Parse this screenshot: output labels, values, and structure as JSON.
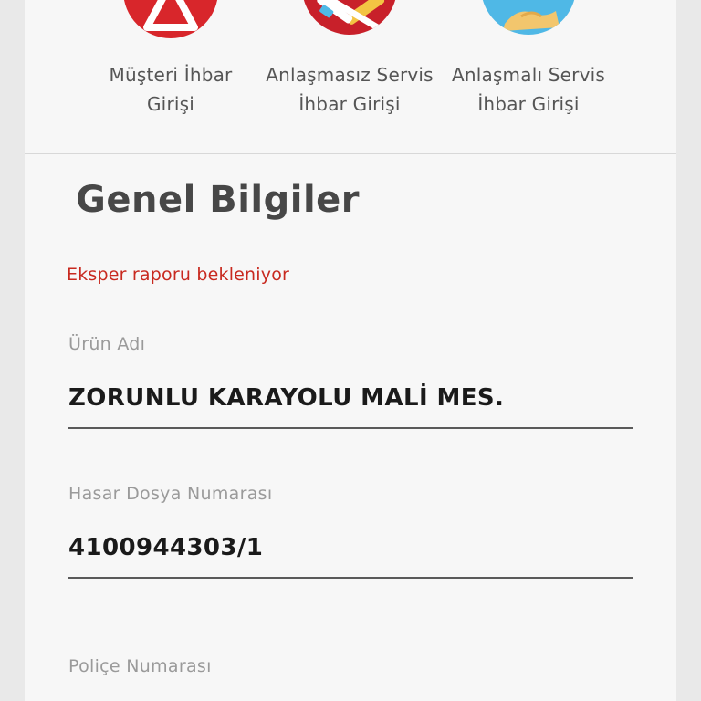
{
  "shortcuts": [
    {
      "label_line1": "Müşteri İhbar",
      "label_line2": "Girişi",
      "icon": "warning-triangle-icon",
      "color": "#d8262b"
    },
    {
      "label_line1": "Anlaşmasız Servis",
      "label_line2": "İhbar Girişi",
      "icon": "no-tools-icon",
      "color": "#c8202a"
    },
    {
      "label_line1": "Anlaşmalı Servis",
      "label_line2": "İhbar Girişi",
      "icon": "handshake-icon",
      "color": "#4fb8e6"
    }
  ],
  "section": {
    "title": "Genel Bilgiler",
    "status": "Eksper raporu bekleniyor"
  },
  "fields": [
    {
      "label": "Ürün Adı",
      "value": "ZORUNLU KARAYOLU MALİ MES."
    },
    {
      "label": "Hasar Dosya Numarası",
      "value": "4100944303/1"
    },
    {
      "label": "Poliçe Numarası",
      "value": ""
    }
  ],
  "colors": {
    "accent_red": "#c8291f",
    "title_gray": "#474747",
    "label_gray": "#9a9a9a"
  }
}
